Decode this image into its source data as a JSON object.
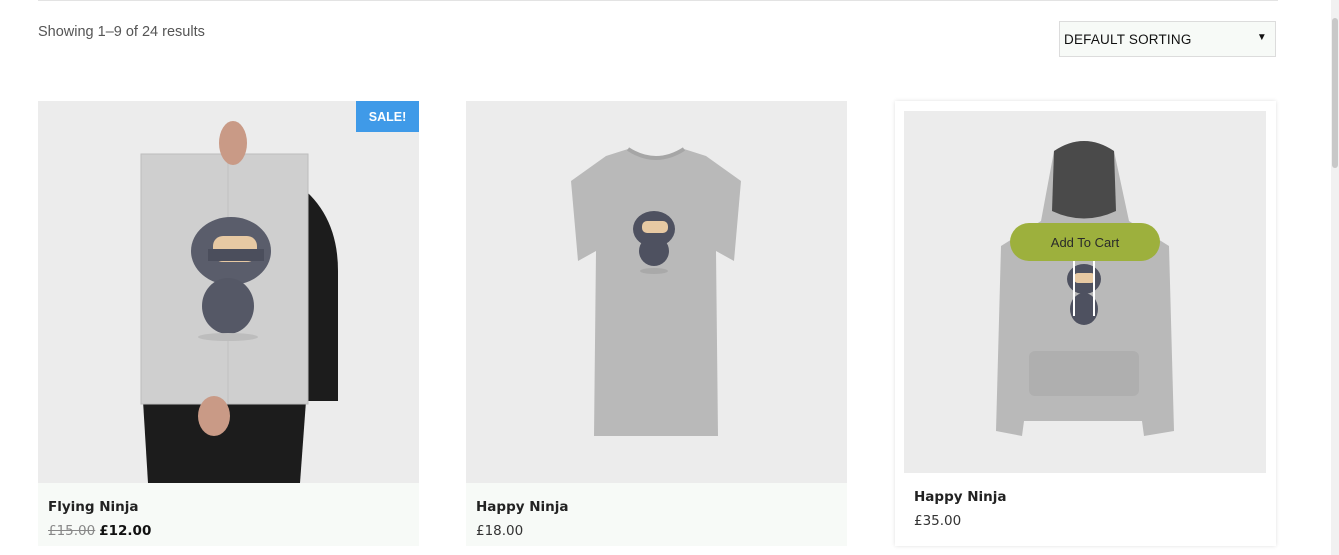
{
  "toolbar": {
    "result_count": "Showing 1–9 of 24 results",
    "sort_selected": "DEFAULT SORTING"
  },
  "products": [
    {
      "title": "Flying Ninja",
      "price_old": "£15.00",
      "price_new": "£12.00",
      "badge": "SALE!",
      "image": "poster"
    },
    {
      "title": "Happy Ninja",
      "price": "£18.00",
      "image": "tshirt"
    },
    {
      "title": "Happy Ninja",
      "price": "£35.00",
      "image": "hoodie",
      "cta": "Add To Cart"
    }
  ],
  "colors": {
    "sale_badge": "#3f9ae8",
    "add_to_cart": "#9db03d",
    "accent_price": "#b9793e",
    "card_bg": "#f7faf7"
  }
}
